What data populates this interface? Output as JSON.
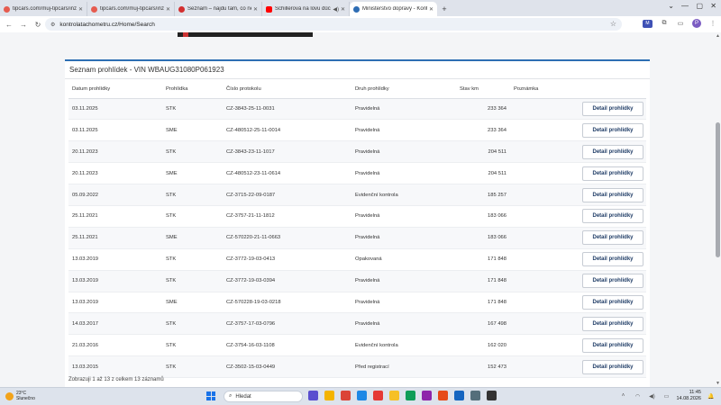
{
  "browser": {
    "tabs": [
      {
        "title": "tipcars.com/muj-tipcars/inzerc",
        "favicon_color": "#e65b4f"
      },
      {
        "title": "tipcars.com/muj-tipcars/inzerc",
        "favicon_color": "#e65b4f"
      },
      {
        "title": "Seznam – najdu tam, co nezná",
        "favicon_color": "#d32f2f"
      },
      {
        "title": "Schillerová na lovu důchod",
        "favicon_color": "#ff0000"
      },
      {
        "title": "Ministerstvo dopravy - Kontro",
        "favicon_color": "#2e6db4"
      }
    ],
    "url": "kontrolatachometru.cz/Home/Search",
    "profile_initial": "P",
    "extension_label": "M"
  },
  "card": {
    "title": "Seznam prohlídek - VIN WBAUG31080P061923"
  },
  "table": {
    "headers": {
      "date": "Datum prohlídky",
      "type": "Prohlídka",
      "protocol": "Číslo protokolu",
      "kind": "Druh prohlídky",
      "km": "Stav km",
      "note": "Poznámka"
    },
    "rows": [
      {
        "date": "03.11.2025",
        "type": "STK",
        "protocol": "CZ-3843-25-11-0031",
        "kind": "Pravidelná",
        "km": "233 364",
        "note": "",
        "action": "Detail prohlídky"
      },
      {
        "date": "03.11.2025",
        "type": "SME",
        "protocol": "CZ-480512-25-11-0014",
        "kind": "Pravidelná",
        "km": "233 364",
        "note": "",
        "action": "Detail prohlídky"
      },
      {
        "date": "20.11.2023",
        "type": "STK",
        "protocol": "CZ-3843-23-11-1017",
        "kind": "Pravidelná",
        "km": "204 511",
        "note": "",
        "action": "Detail prohlídky"
      },
      {
        "date": "20.11.2023",
        "type": "SME",
        "protocol": "CZ-480512-23-11-0614",
        "kind": "Pravidelná",
        "km": "204 511",
        "note": "",
        "action": "Detail prohlídky"
      },
      {
        "date": "05.09.2022",
        "type": "STK",
        "protocol": "CZ-3715-22-09-0187",
        "kind": "Evidenční kontrola",
        "km": "185 257",
        "note": "",
        "action": "Detail prohlídky"
      },
      {
        "date": "25.11.2021",
        "type": "STK",
        "protocol": "CZ-3757-21-11-1812",
        "kind": "Pravidelná",
        "km": "183 066",
        "note": "",
        "action": "Detail prohlídky"
      },
      {
        "date": "25.11.2021",
        "type": "SME",
        "protocol": "CZ-570220-21-11-0663",
        "kind": "Pravidelná",
        "km": "183 066",
        "note": "",
        "action": "Detail prohlídky"
      },
      {
        "date": "13.03.2019",
        "type": "STK",
        "protocol": "CZ-3772-19-03-0413",
        "kind": "Opakovaná",
        "km": "171 848",
        "note": "",
        "action": "Detail prohlídky"
      },
      {
        "date": "13.03.2019",
        "type": "STK",
        "protocol": "CZ-3772-19-03-0394",
        "kind": "Pravidelná",
        "km": "171 848",
        "note": "",
        "action": "Detail prohlídky"
      },
      {
        "date": "13.03.2019",
        "type": "SME",
        "protocol": "CZ-570228-19-03-0218",
        "kind": "Pravidelná",
        "km": "171 848",
        "note": "",
        "action": "Detail prohlídky"
      },
      {
        "date": "14.03.2017",
        "type": "STK",
        "protocol": "CZ-3757-17-03-0796",
        "kind": "Pravidelná",
        "km": "167 498",
        "note": "",
        "action": "Detail prohlídky"
      },
      {
        "date": "21.03.2016",
        "type": "STK",
        "protocol": "CZ-3754-16-03-1108",
        "kind": "Evidenční kontrola",
        "km": "162 020",
        "note": "",
        "action": "Detail prohlídky"
      },
      {
        "date": "13.03.2015",
        "type": "STK",
        "protocol": "CZ-3502-15-03-0449",
        "kind": "Před registrací",
        "km": "152 473",
        "note": "",
        "action": "Detail prohlídky"
      }
    ]
  },
  "footer": {
    "info": "Zobrazuji 1 až 13 z celkem 13 záznamů"
  },
  "taskbar": {
    "weather_temp": "23°C",
    "weather_desc": "Slunečno",
    "search_placeholder": "Hledat",
    "time": "11:45",
    "date": "14.08.2026",
    "app_colors": [
      "#5a4fcf",
      "#f4b400",
      "#db4437",
      "#1e88e5",
      "#e53935",
      "#f6c026",
      "#0f9d58",
      "#8e24aa",
      "#e64a19",
      "#1565c0",
      "#546e7a",
      "#333333"
    ]
  }
}
